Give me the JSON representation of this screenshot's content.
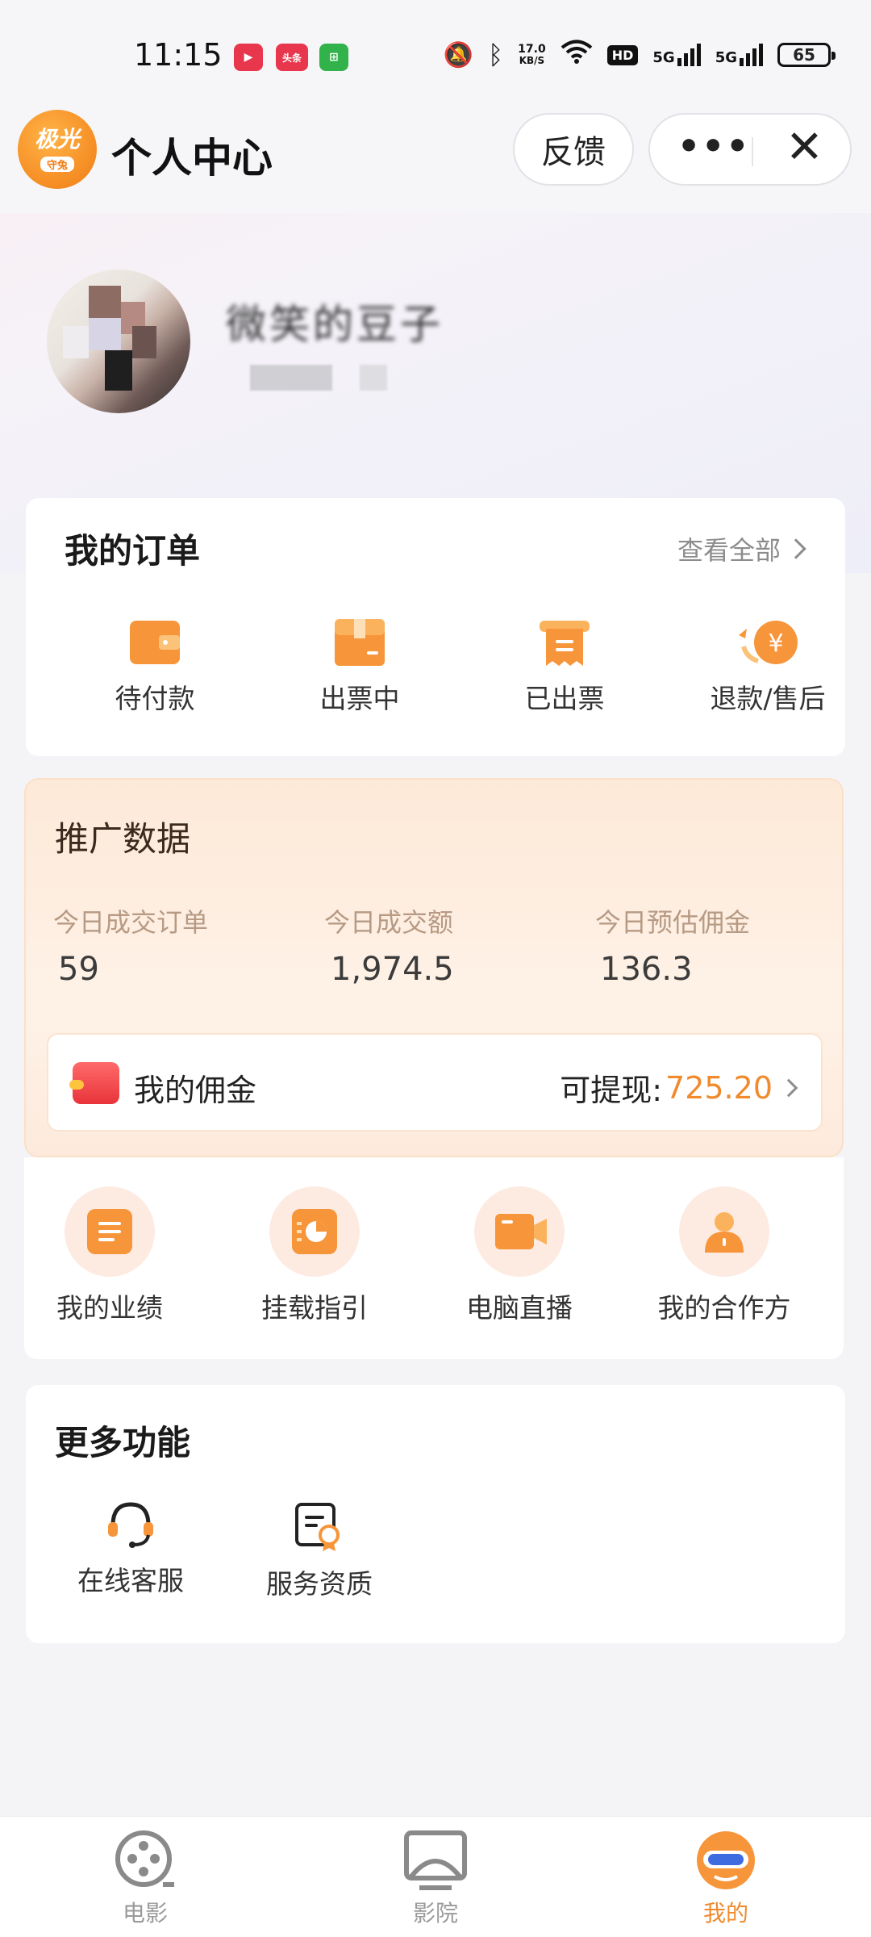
{
  "status_bar": {
    "time": "11:15",
    "apps": [
      {
        "name": "video-app-icon",
        "label": "▶",
        "color": "#e8364c"
      },
      {
        "name": "toutiao-app-icon",
        "label": "头条",
        "color": "#e8364c"
      },
      {
        "name": "store-app-icon",
        "label": "⊞",
        "color": "#32b24a"
      }
    ],
    "net_speed": "17.0",
    "net_unit": "KB/S",
    "hd_badge": "HD",
    "signal1": "5G",
    "signal2": "5G",
    "battery": "65"
  },
  "header": {
    "logo_text": "极光",
    "logo_sub": "守兔",
    "title": "个人中心",
    "feedback": "反馈",
    "more": "•••",
    "close": "✕"
  },
  "profile": {
    "nickname": "微笑的豆子"
  },
  "orders": {
    "title": "我的订单",
    "view_all": "查看全部",
    "items": [
      {
        "label": "待付款",
        "icon": "wallet-icon"
      },
      {
        "label": "出票中",
        "icon": "ticket-box-icon"
      },
      {
        "label": "已出票",
        "icon": "receipt-icon"
      },
      {
        "label": "退款/售后",
        "icon": "refund-icon"
      }
    ]
  },
  "promo": {
    "title": "推广数据",
    "stats": [
      {
        "label": "今日成交订单",
        "value": "59"
      },
      {
        "label": "今日成交额",
        "value": "1,974.5"
      },
      {
        "label": "今日预估佣金",
        "value": "136.3"
      }
    ],
    "commission_label": "我的佣金",
    "withdraw_label": "可提现:",
    "withdraw_amount": "725.20"
  },
  "tools": [
    {
      "label": "我的业绩",
      "icon": "performance-icon"
    },
    {
      "label": "挂载指引",
      "icon": "guide-icon"
    },
    {
      "label": "电脑直播",
      "icon": "live-camera-icon"
    },
    {
      "label": "我的合作方",
      "icon": "partner-icon"
    }
  ],
  "more": {
    "title": "更多功能",
    "items": [
      {
        "label": "在线客服",
        "icon": "headset-icon"
      },
      {
        "label": "服务资质",
        "icon": "certificate-icon"
      }
    ]
  },
  "tabbar": [
    {
      "label": "电影",
      "icon": "film-reel-icon",
      "active": false
    },
    {
      "label": "影院",
      "icon": "cinema-screen-icon",
      "active": false
    },
    {
      "label": "我的",
      "icon": "mine-mascot-icon",
      "active": true
    }
  ],
  "colors": {
    "accent": "#f08a2c",
    "icon_orange": "#f7953a"
  }
}
